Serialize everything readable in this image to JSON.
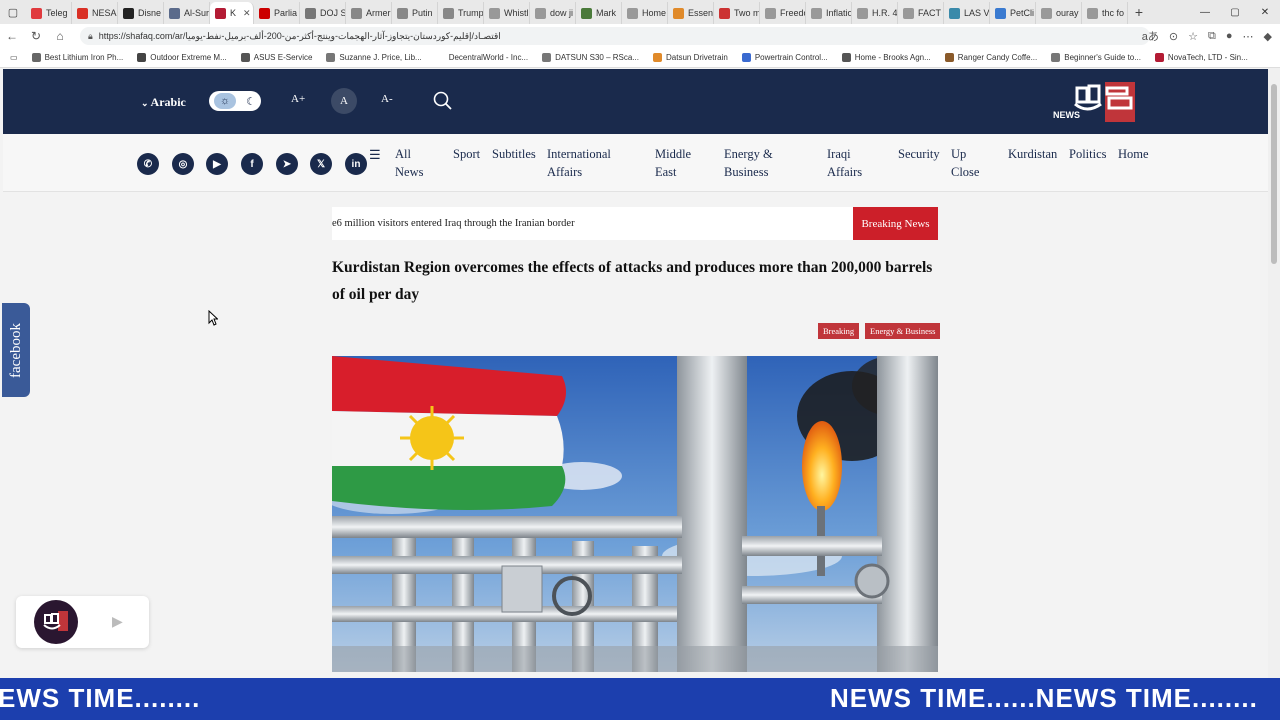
{
  "browser": {
    "tabs": [
      {
        "label": "Teleg",
        "color": "#e03a3e"
      },
      {
        "label": "NESA",
        "color": "#d93025"
      },
      {
        "label": "Disne",
        "color": "#222222"
      },
      {
        "label": "Al-Sur",
        "color": "#5b6b8b"
      },
      {
        "label": "K",
        "color": "#b31b34",
        "active": true
      },
      {
        "label": "Parlia",
        "color": "#cc0000"
      },
      {
        "label": "DOJ S",
        "color": "#777777"
      },
      {
        "label": "Armer",
        "color": "#888888"
      },
      {
        "label": "Putin",
        "color": "#888888"
      },
      {
        "label": "Trump",
        "color": "#888888"
      },
      {
        "label": "Whistl",
        "color": "#999999"
      },
      {
        "label": "dow ji",
        "color": "#999999"
      },
      {
        "label": "Mark",
        "color": "#4a7a3a"
      },
      {
        "label": "Home",
        "color": "#999999"
      },
      {
        "label": "Essent",
        "color": "#e08a2a"
      },
      {
        "label": "Two m",
        "color": "#cc3333"
      },
      {
        "label": "Freedo",
        "color": "#999999"
      },
      {
        "label": "Inflatio",
        "color": "#999999"
      },
      {
        "label": "H.R. 4",
        "color": "#999999"
      },
      {
        "label": "FACT",
        "color": "#999999"
      },
      {
        "label": "LAS V",
        "color": "#3a8aaa"
      },
      {
        "label": "PetCli",
        "color": "#3a7ad0"
      },
      {
        "label": "ouray",
        "color": "#999999"
      },
      {
        "label": "thc fo",
        "color": "#999999"
      }
    ],
    "url": "https://shafaq.com/ar/اقتصـاد/إقليم-كوردستان-يتجاوز-آثار-الهجمات-وينتج-أكثر-من-200-ألف-برميل-نفط-يوميا",
    "bookmarks": [
      {
        "label": "Best Lithium Iron Ph...",
        "color": "#666666"
      },
      {
        "label": "Outdoor Extreme M...",
        "color": "#444444"
      },
      {
        "label": "ASUS E-Service",
        "color": "#555555"
      },
      {
        "label": "Suzanne J. Price, Lib...",
        "color": "#777777"
      },
      {
        "label": "DecentralWorld - Inc...",
        "color": "#ffffff"
      },
      {
        "label": "DATSUN S30 – RSca...",
        "color": "#777777"
      },
      {
        "label": "Datsun Drivetrain",
        "color": "#e08a2a"
      },
      {
        "label": "Powertrain Control...",
        "color": "#3a6ad0"
      },
      {
        "label": "Home - Brooks Agn...",
        "color": "#555555"
      },
      {
        "label": "Ranger Candy Coffe...",
        "color": "#8a5a2a"
      },
      {
        "label": "Beginner's Guide to...",
        "color": "#777777"
      },
      {
        "label": "NovaTech, LTD - Sin...",
        "color": "#b31b34"
      }
    ]
  },
  "header": {
    "language": "Arabic",
    "font_plus": "A+",
    "font_normal": "A",
    "font_minus": "A-",
    "logo_news": "NEWS"
  },
  "nav": {
    "social": [
      {
        "name": "whatsapp-icon",
        "glyph": "✆"
      },
      {
        "name": "instagram-icon",
        "glyph": "◎"
      },
      {
        "name": "youtube-icon",
        "glyph": "▶"
      },
      {
        "name": "facebook-icon",
        "glyph": "f"
      },
      {
        "name": "telegram-icon",
        "glyph": "➤"
      },
      {
        "name": "x-icon",
        "glyph": "𝕏"
      },
      {
        "name": "linkedin-icon",
        "glyph": "in"
      }
    ],
    "links": [
      {
        "key": "all-news",
        "label": "All News"
      },
      {
        "key": "sport",
        "label": "Sport"
      },
      {
        "key": "subtitles",
        "label": "Subtitles"
      },
      {
        "key": "international-affairs",
        "label": "International Affairs"
      },
      {
        "key": "middle-east",
        "label": "Middle East"
      },
      {
        "key": "energy-business",
        "label": "Energy & Business"
      },
      {
        "key": "iraqi-affairs",
        "label": "Iraqi Affairs"
      },
      {
        "key": "security",
        "label": "Security"
      },
      {
        "key": "up-close",
        "label": "Up Close"
      },
      {
        "key": "kurdistan",
        "label": "Kurdistan"
      },
      {
        "key": "politics",
        "label": "Politics"
      },
      {
        "key": "home",
        "label": "Home"
      }
    ]
  },
  "ticker": {
    "text": "e6 million visitors entered Iraq through the Iranian border",
    "button": "Breaking News"
  },
  "article": {
    "headline": "Kurdistan Region overcomes the effects of attacks and produces more than 200,000 barrels of oil per day",
    "tags": [
      "Breaking",
      "Energy & Business"
    ]
  },
  "facebook_tab": "facebook",
  "banner": {
    "text_left": "EWS TIME........",
    "text_right": "NEWS TIME......NEWS TIME........"
  },
  "colors": {
    "header_bg": "#1a2a4c",
    "breaking_red": "#cc1f29",
    "tag_red": "#c0353a",
    "banner_blue": "#1c3fae",
    "facebook_blue": "#3a5a98"
  }
}
